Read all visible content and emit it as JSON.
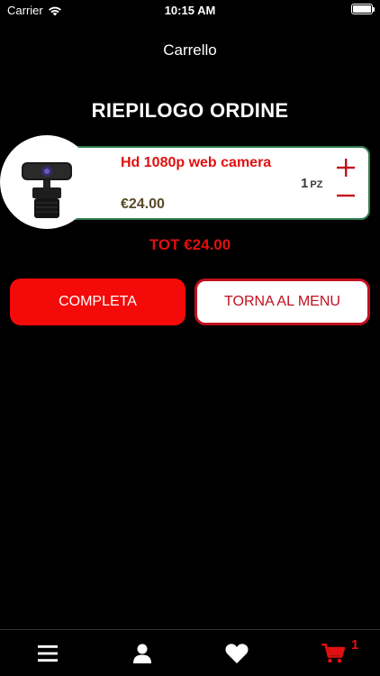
{
  "status_bar": {
    "carrier": "Carrier",
    "time": "10:15 AM"
  },
  "nav": {
    "title": "Carrello"
  },
  "order": {
    "title": "RIEPILOGO ORDINE",
    "items": [
      {
        "name": "Hd 1080p web camera",
        "price": "€24.00",
        "quantity": "1",
        "unit": "PZ",
        "increment_icon": "plus-icon",
        "decrement_icon": "minus-icon"
      }
    ],
    "total": "TOT €24.00"
  },
  "actions": {
    "complete_label": "COMPLETA",
    "back_label": "TORNA AL MENU"
  },
  "tab_bar": {
    "items": [
      {
        "icon": "menu-icon"
      },
      {
        "icon": "user-icon"
      },
      {
        "icon": "heart-icon"
      },
      {
        "icon": "cart-icon",
        "badge": "1"
      }
    ]
  },
  "colors": {
    "accent": "#f50a0a",
    "price": "#5a4a2a",
    "card_border": "#2e7d4f"
  }
}
